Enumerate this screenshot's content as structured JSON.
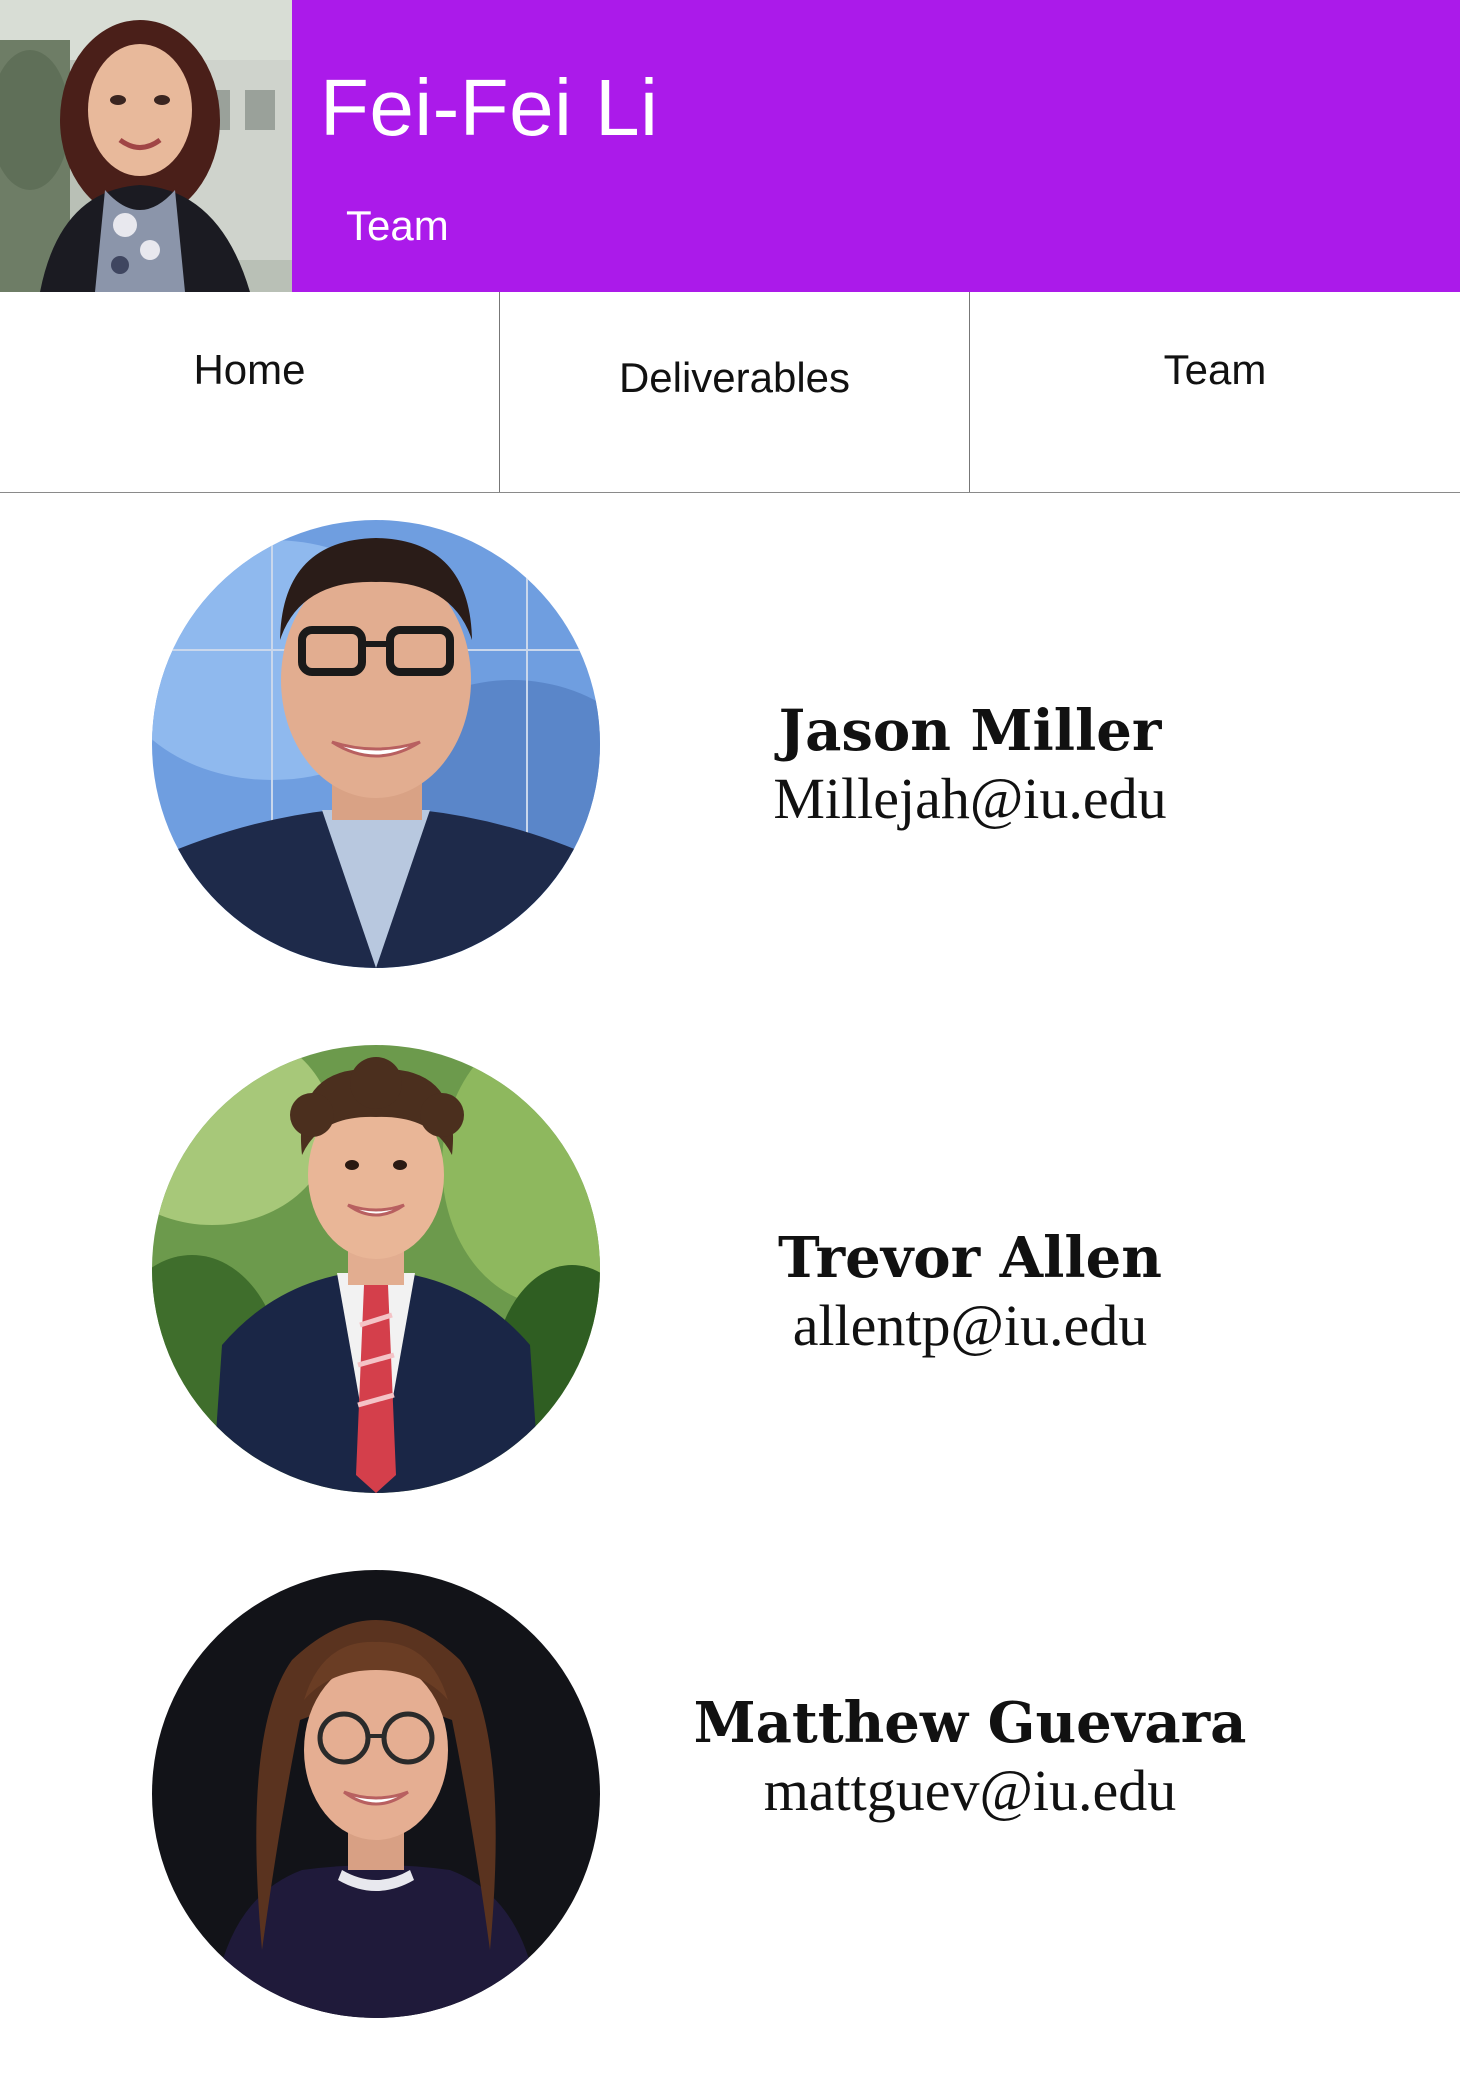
{
  "header": {
    "title": "Fei-Fei Li",
    "subtitle": "Team",
    "banner_color": "#ab1aea"
  },
  "nav": {
    "items": [
      {
        "label": "Home"
      },
      {
        "label": "Deliverables"
      },
      {
        "label": "Team"
      }
    ]
  },
  "team": {
    "members": [
      {
        "name": "Jason Miller",
        "email": "Millejah@iu.edu"
      },
      {
        "name": "Trevor Allen",
        "email": "allentp@iu.edu"
      },
      {
        "name": "Matthew Guevara",
        "email": "mattguev@iu.edu"
      }
    ]
  }
}
